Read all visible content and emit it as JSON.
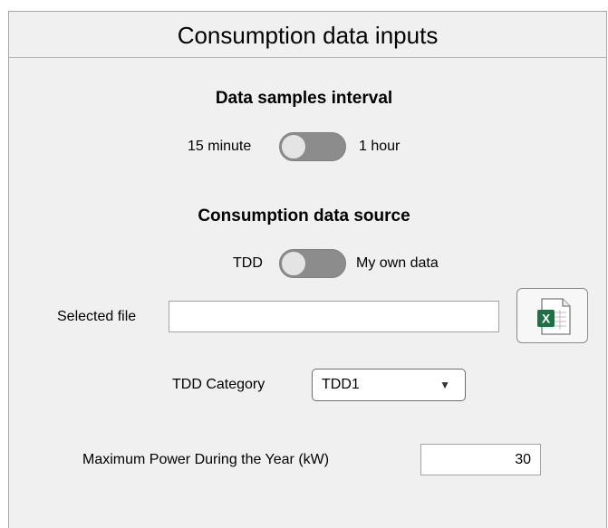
{
  "panel": {
    "title": "Consumption data inputs"
  },
  "interval": {
    "heading": "Data samples interval",
    "left_label": "15 minute",
    "right_label": "1 hour"
  },
  "source": {
    "heading": "Consumption data source",
    "left_label": "TDD",
    "right_label": "My own data"
  },
  "file": {
    "label": "Selected file",
    "value": "",
    "browse_icon": "excel-file-icon",
    "browse_icon_letter": "X"
  },
  "tdd_category": {
    "label": "TDD Category",
    "selected": "TDD1",
    "arrow": "▼"
  },
  "max_power": {
    "label": "Maximum Power During the Year (kW)",
    "value": "30"
  },
  "colors": {
    "panel_bg": "#f0f0f0",
    "switch_track": "#8c8c8c",
    "excel_green": "#1e7145"
  }
}
